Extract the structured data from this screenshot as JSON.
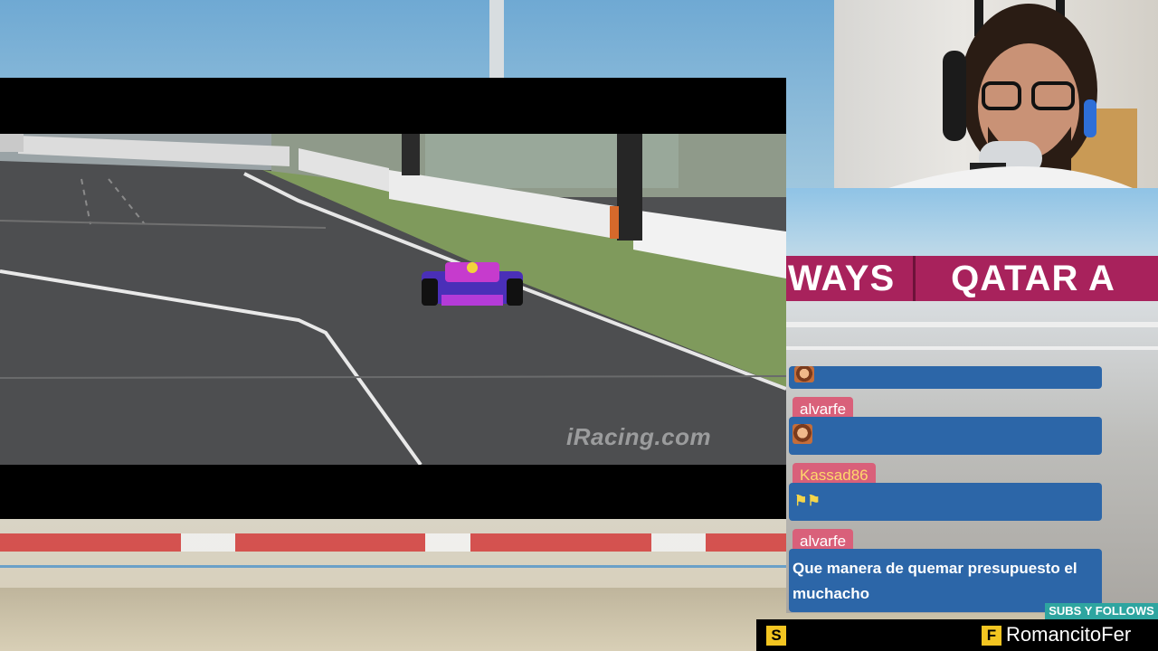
{
  "game": {
    "watermark": "iRacing.com"
  },
  "scene": {
    "banner_left": "WAYS",
    "banner_right": "QATAR A"
  },
  "chat": {
    "messages": [
      {
        "user": "",
        "content": "",
        "emote": "face-emote"
      },
      {
        "user": "alvarfe",
        "content": "",
        "emote": "face-emote"
      },
      {
        "user": "Kassad86",
        "content": "",
        "emote": "checkered-flags-emote"
      },
      {
        "user": "alvarfe",
        "content": "Que manera de quemar presupuesto el muchacho"
      }
    ]
  },
  "bottom_bar": {
    "subs_label": "SUBS Y FOLLOWS",
    "social_icon_s": "S",
    "social_icon_f": "F",
    "handle": "RomancitoFer"
  },
  "colors": {
    "chat_bubble": "#2c66a8",
    "chat_name_bg": "#d9607a",
    "subs_label_bg": "#2ea5a0",
    "social_icon_bg": "#f3c521"
  }
}
